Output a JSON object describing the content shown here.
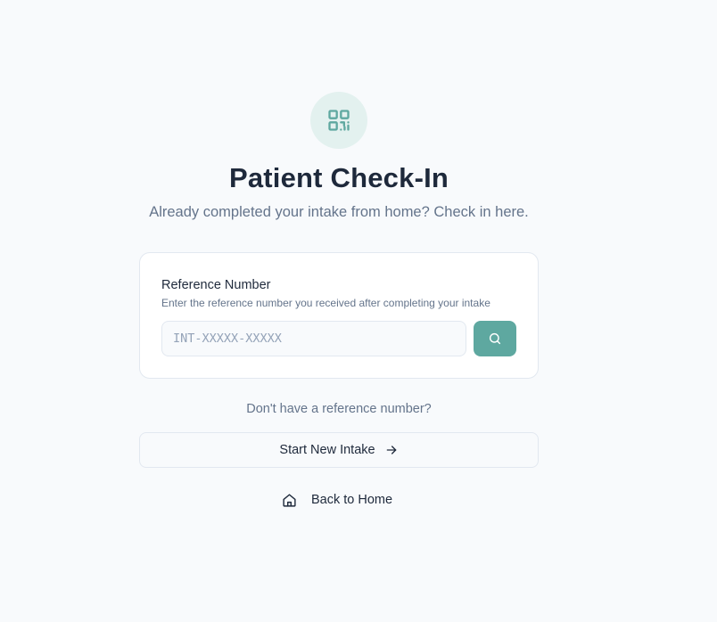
{
  "header": {
    "icon": "qr-code-icon",
    "title": "Patient Check-In",
    "subtitle": "Already completed your intake from home? Check in here."
  },
  "reference_card": {
    "label": "Reference Number",
    "hint": "Enter the reference number you received after completing your intake",
    "input": {
      "value": "",
      "placeholder": "INT-XXXXX-XXXXX"
    },
    "search_icon": "search-icon"
  },
  "alternate": {
    "prompt": "Don't have a reference number?",
    "start_label": "Start New Intake",
    "start_icon": "arrow-right-icon"
  },
  "footer": {
    "home_label": "Back to Home",
    "home_icon": "home-icon"
  },
  "colors": {
    "accent": "#5ea8a0",
    "accent_light": "#e3f1ef",
    "text_primary": "#1e293b",
    "text_muted": "#64748b",
    "background": "#f8fafc",
    "border": "#e2e8f0"
  }
}
